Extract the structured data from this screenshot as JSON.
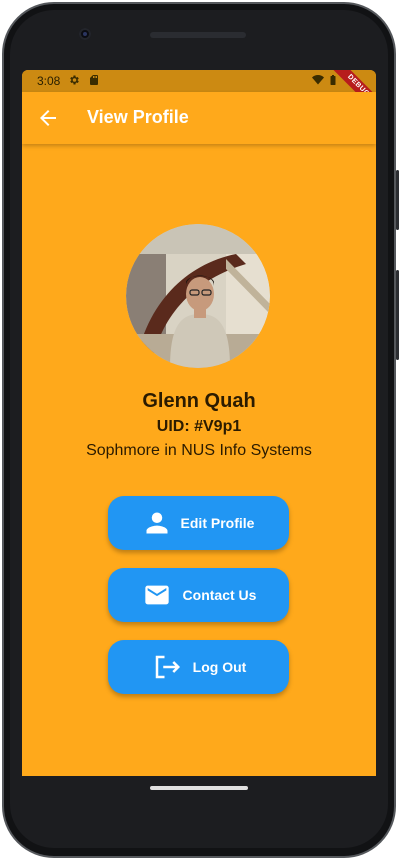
{
  "status_bar": {
    "time": "3:08"
  },
  "app_bar": {
    "title": "View Profile"
  },
  "debug_banner": "DEBUG",
  "profile": {
    "name": "Glenn Quah",
    "uid": "UID: #V9p1",
    "subtitle": "Sophmore in NUS Info Systems"
  },
  "buttons": {
    "edit_profile": "Edit Profile",
    "contact_us": "Contact Us",
    "log_out": "Log Out"
  },
  "colors": {
    "background": "#FFA91B",
    "status_bar": "#CC8A12",
    "button": "#2196F3",
    "text": "#2b1b00"
  },
  "icons": [
    "arrow-back-icon",
    "person-icon",
    "email-icon",
    "logout-icon",
    "wifi-icon",
    "battery-icon",
    "settings-icon",
    "sd-card-icon"
  ]
}
